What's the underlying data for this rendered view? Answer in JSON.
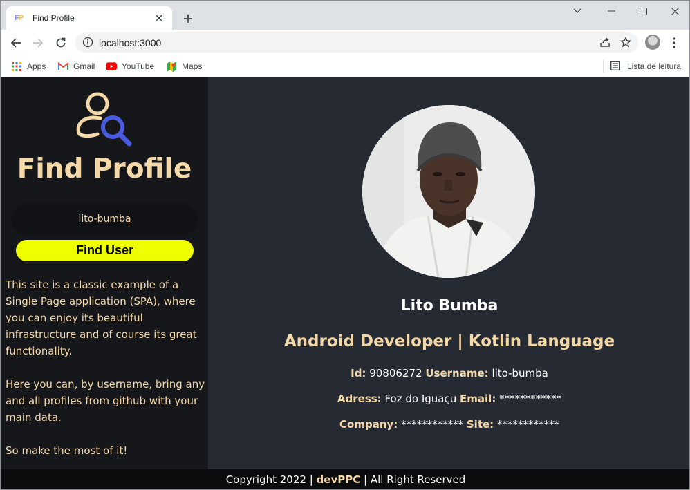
{
  "browser": {
    "tab_title": "Find Profile",
    "favicon_text": "FP",
    "url": "localhost:3000",
    "bookmarks": [
      {
        "label": "Apps",
        "icon": "apps-grid-icon"
      },
      {
        "label": "Gmail",
        "icon": "gmail-icon"
      },
      {
        "label": "YouTube",
        "icon": "youtube-icon"
      },
      {
        "label": "Maps",
        "icon": "maps-icon"
      }
    ],
    "reading_list": "Lista de leitura"
  },
  "app": {
    "title": "Find Profile",
    "search_value": "lito-bumba",
    "button_label": "Find User",
    "about": [
      "This site is a classic example of a Single Page application (SPA), where you can enjoy its beautiful infrastructure and of course its great functionality.",
      "Here you can, by username, bring any and all profiles from github with your main data.",
      "So make the most of it!"
    ]
  },
  "profile": {
    "name": "Lito Bumba",
    "bio": "Android Developer | Kotlin Language",
    "id_label": "Id:",
    "id_value": "90806272",
    "username_label": "Username:",
    "username_value": "lito-bumba",
    "address_label": "Adress:",
    "address_value": "Foz do Iguaçu",
    "email_label": "Email:",
    "email_value": "************",
    "company_label": "Company:",
    "company_value": "************",
    "site_label": "Site:",
    "site_value": "************"
  },
  "footer": {
    "prefix": "Copyright 2022 |",
    "brand": "devPPC",
    "suffix": "| All Right Reserved"
  },
  "colors": {
    "accent": "#f4d8a8",
    "button": "#eeff00",
    "sidebar_bg": "#16171b",
    "main_bg": "#262a33"
  }
}
